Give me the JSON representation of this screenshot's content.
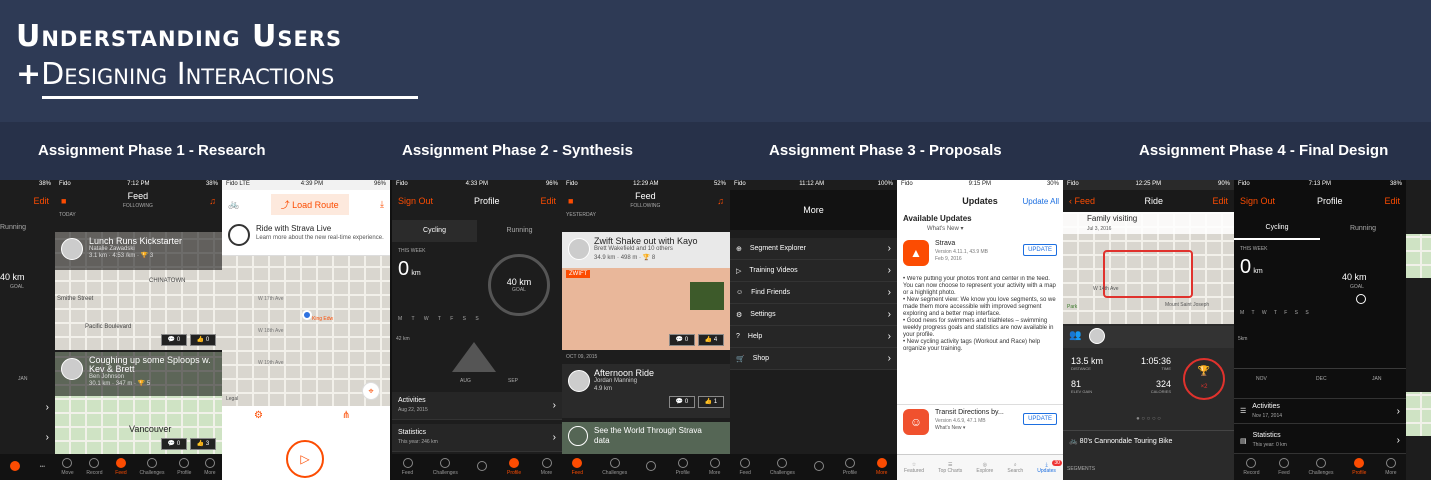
{
  "header": {
    "title_line1": "Understanding Users",
    "title_plus": "+",
    "title_line2": "Designing Interactions"
  },
  "phases": [
    "Assignment Phase 1 - Research",
    "Assignment Phase 2 - Synthesis",
    "Assignment Phase 3 - Proposals",
    "Assignment Phase 4 - Final Design"
  ],
  "colors": {
    "banner": "#2e3a55",
    "phasebar": "#273149",
    "strava_orange": "#fc4c02",
    "ios_blue": "#1d6fe0"
  },
  "screens": {
    "edge_left": {
      "battery": "38%",
      "edit": "Edit",
      "running": "Running",
      "distance": "40 km",
      "goal": "GOAL",
      "month": "JAN"
    },
    "feed1": {
      "carrier": "Fido",
      "time": "7:12 PM",
      "battery": "38%",
      "title": "Feed",
      "subtitle": "FOLLOWING",
      "section": "TODAY",
      "card1": {
        "title": "Lunch Runs Kickstarter",
        "author": "Natalie Zawadski",
        "dist": "3.1 km",
        "pace": "4:53 /km",
        "count": "3",
        "kudos": "0",
        "likes": "0"
      },
      "map1": {
        "l1": "CHINATOWN",
        "l2": "Pacific Boulevard",
        "l3": "Smithe Street"
      },
      "card2": {
        "title": "Coughing up some Sploops w. Kev & Brett",
        "author": "Ben Johnson",
        "dist": "30.1 km",
        "elev": "347 m",
        "count": "5",
        "kudos": "0",
        "likes": "3"
      },
      "map2": {
        "l1": "Vancouver"
      }
    },
    "route": {
      "carrier": "Fido",
      "network": "LTE",
      "time": "4:39 PM",
      "battery": "96%",
      "load": "Load Route",
      "live_title": "Ride with Strava Live",
      "live_desc": "Learn more about the new real-time experience.",
      "street1": "W 17th Ave",
      "street2": "W 18th Ave",
      "street3": "W 19th Ave",
      "place": "King Edw",
      "legal": "Legal"
    },
    "profile1": {
      "carrier": "Fido",
      "time": "4:33 PM",
      "battery": "96%",
      "signout": "Sign Out",
      "title": "Profile",
      "edit": "Edit",
      "tab1": "Cycling",
      "tab2": "Running",
      "week": "THIS WEEK",
      "zero": "0",
      "unit": "km",
      "goal": "40 km",
      "goal_lbl": "GOAL",
      "days": "M T W T F S S",
      "axis": "42 km",
      "m1": "AUG",
      "m2": "SEP",
      "activities": "Activities",
      "activities_date": "Aug 22, 2015",
      "stats": "Statistics",
      "stats_sub": "This year: 246 km"
    },
    "feed2": {
      "carrier": "Fido",
      "time": "12:29 AM",
      "battery": "52%",
      "title": "Feed",
      "subtitle": "FOLLOWING",
      "section": "YESTERDAY",
      "card1": {
        "title": "Zwift Shake out with Kayo",
        "author": "Brett Wakefield and 10 others",
        "dist": "34.9 km",
        "elev": "498 m",
        "count": "8",
        "kudos": "0",
        "likes": "4"
      },
      "brand": "ZWIFT",
      "date2": "OCT 09, 2015",
      "card2": {
        "title": "Afternoon Ride",
        "author": "Jordan Manning",
        "dist": "4.9 km",
        "kudos": "0",
        "likes": "1"
      },
      "card3": {
        "title": "See the World Through Strava",
        "sub": "data"
      }
    },
    "more": {
      "carrier": "Fido",
      "time": "11:12 AM",
      "battery": "100%",
      "title": "More",
      "items": [
        "Segment Explorer",
        "Training Videos",
        "Find Friends",
        "Settings",
        "Help",
        "Shop"
      ]
    },
    "appstore": {
      "carrier": "Fido",
      "time": "9:15 PM",
      "battery": "30%",
      "title": "Updates",
      "update_all": "Update All",
      "section": "Available Updates",
      "whats_new": "What's New ▾",
      "strava": {
        "name": "Strava",
        "version": "Version 4.11.1, 43.9 MB",
        "date": "Feb 9, 2016",
        "btn": "UPDATE",
        "notes": "• We're putting your photos front and center in the feed. You can now choose to represent your activity with a map or a highlight photo.\n• New segment view: We know you love segments, so we made them more accessible with improved segment exploring and a better map interface.\n• Good news for swimmers and triathletes – swimming weekly progress goals and statistics are now available in your profile.\n• New cycling activity tags (Workout and Race) help organize your training."
      },
      "transit": {
        "name": "Transit Directions by...",
        "version": "Version 4.6.9, 47.1 MB",
        "whats_new": "What's New ▾",
        "btn": "UPDATE"
      },
      "tabs": [
        "Featured",
        "Top Charts",
        "Explore",
        "Search",
        "Updates"
      ],
      "badge": "30"
    },
    "ride": {
      "carrier": "Fido",
      "time": "12:25 PM",
      "battery": "90%",
      "back": "Feed",
      "title": "Ride",
      "edit": "Edit",
      "activity": "Family visiting",
      "date": "Jul 3, 2016",
      "dist": "13.5 km",
      "dist_lbl": "DISTANCE",
      "time_val": "1:05:36",
      "time_lbl": "TIME",
      "elev": "81",
      "elev_lbl": "ELEV GAIN",
      "cal": "324",
      "cal_lbl": "CALORIES",
      "trophy": "×2",
      "bike": "80's Cannondale Touring Bike",
      "segments": "SEGMENTS",
      "street": "W 14th Ave",
      "place": "Mount Saint Joseph",
      "park": "Park"
    },
    "profile2": {
      "carrier": "Fido",
      "time": "7:13 PM",
      "battery": "38%",
      "signout": "Sign Out",
      "title": "Profile",
      "edit": "Edit",
      "tab1": "Cycling",
      "tab2": "Running",
      "week": "THIS WEEK",
      "zero": "0",
      "unit": "km",
      "goal": "40 km",
      "goal_lbl": "GOAL",
      "axis": "5km",
      "m1": "NOV",
      "m2": "DEC",
      "m3": "JAN",
      "activities": "Activities",
      "activities_date": "Nov 17, 2014",
      "stats": "Statistics",
      "stats_sub": "This year: 0 km"
    },
    "tabs_a": [
      "Feed",
      "Challenges",
      "Record",
      "Profile",
      "More"
    ],
    "tabs_b": [
      "Move",
      "Record",
      "Feed",
      "Challenges",
      "Profile",
      "More"
    ]
  }
}
